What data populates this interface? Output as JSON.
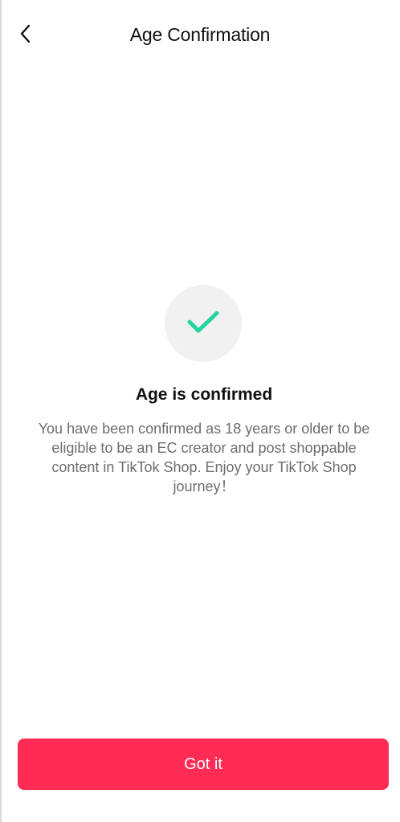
{
  "header": {
    "title": "Age Confirmation",
    "back_icon": "chevron-left-icon"
  },
  "status": {
    "icon": "checkmark-icon",
    "icon_color": "#20d5a0",
    "title": "Age is confirmed",
    "description": "You have been confirmed as 18 years or older to be eligible to be an EC creator and post shoppable content in TikTok Shop. Enjoy your TikTok Shop journey！"
  },
  "actions": {
    "primary_label": "Got it",
    "primary_color": "#fe2c55"
  }
}
